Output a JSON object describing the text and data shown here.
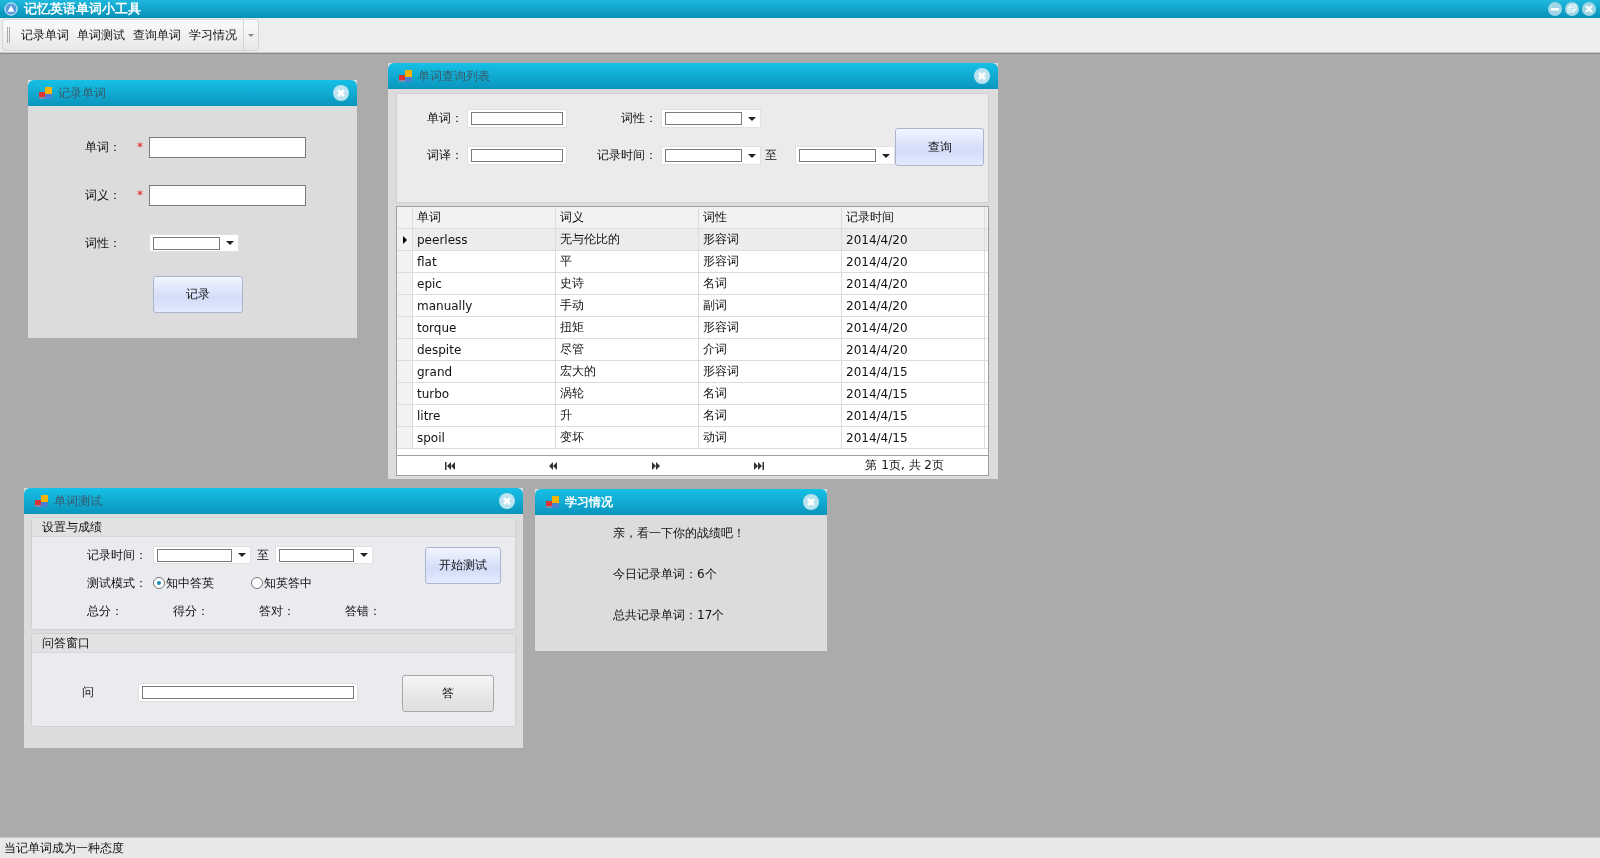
{
  "app": {
    "title": "记忆英语单词小工具"
  },
  "toolbar": [
    {
      "label": "记录单词"
    },
    {
      "label": "单词测试"
    },
    {
      "label": "查询单词"
    },
    {
      "label": "学习情况"
    }
  ],
  "windows": [
    {
      "kind": "record",
      "title": "记录单词",
      "active": false,
      "fields": [
        {
          "label": "单词：",
          "marker": "*",
          "kind": "text"
        },
        {
          "label": "词义：",
          "marker": "*",
          "kind": "text"
        },
        {
          "label": "词性：",
          "kind": "combo"
        }
      ],
      "button": "记录"
    },
    {
      "kind": "query",
      "title": "单词查询列表",
      "active": false,
      "word_label": "单词：",
      "pos_label": "词性：",
      "trans_label": "词译：",
      "time_label": "记录时间：",
      "to_label": "至",
      "button": "查询",
      "table": {
        "columns": [
          "单词",
          "词义",
          "词性",
          "记录时间"
        ],
        "rows": [
          {
            "cells": [
              "peerless",
              "无与伦比的",
              "形容词",
              "2014/4/20"
            ],
            "selected": true
          },
          {
            "cells": [
              "flat",
              "平",
              "形容词",
              "2014/4/20"
            ],
            "selected": false
          },
          {
            "cells": [
              "epic",
              "史诗",
              "名词",
              "2014/4/20"
            ],
            "selected": false
          },
          {
            "cells": [
              "manually",
              "手动",
              "副词",
              "2014/4/20"
            ],
            "selected": false
          },
          {
            "cells": [
              "torque",
              "扭矩",
              "形容词",
              "2014/4/20"
            ],
            "selected": false
          },
          {
            "cells": [
              "despite",
              "尽管",
              "介词",
              "2014/4/20"
            ],
            "selected": false
          },
          {
            "cells": [
              "grand",
              "宏大的",
              "形容词",
              "2014/4/15"
            ],
            "selected": false
          },
          {
            "cells": [
              "turbo",
              "涡轮",
              "名词",
              "2014/4/15"
            ],
            "selected": false
          },
          {
            "cells": [
              "litre",
              "升",
              "名词",
              "2014/4/15"
            ],
            "selected": false
          },
          {
            "cells": [
              "spoil",
              "变坏",
              "动词",
              "2014/4/15"
            ],
            "selected": false
          }
        ]
      },
      "pager": "第 1页, 共 2页"
    },
    {
      "kind": "test",
      "title": "单词测试",
      "active": false,
      "settings_title": "设置与成绩",
      "time_label": "记录时间：",
      "to_label": "至",
      "start_button": "开始测试",
      "mode_label": "测试模式：",
      "modes": [
        {
          "label": "知中答英",
          "selected": true
        },
        {
          "label": "知英答中",
          "selected": false
        }
      ],
      "scores": [
        "总分：",
        "得分：",
        "答对：",
        "答错："
      ],
      "qa_title": "问答窗口",
      "question_label": "问",
      "answer_button": "答"
    },
    {
      "kind": "stats",
      "title": "学习情况",
      "active": true,
      "lines": [
        "亲，看一下你的战绩吧！",
        "今日记录单词：6个",
        "总共记录单词：17个"
      ]
    }
  ],
  "status_bar": "当记单词成为一种态度"
}
